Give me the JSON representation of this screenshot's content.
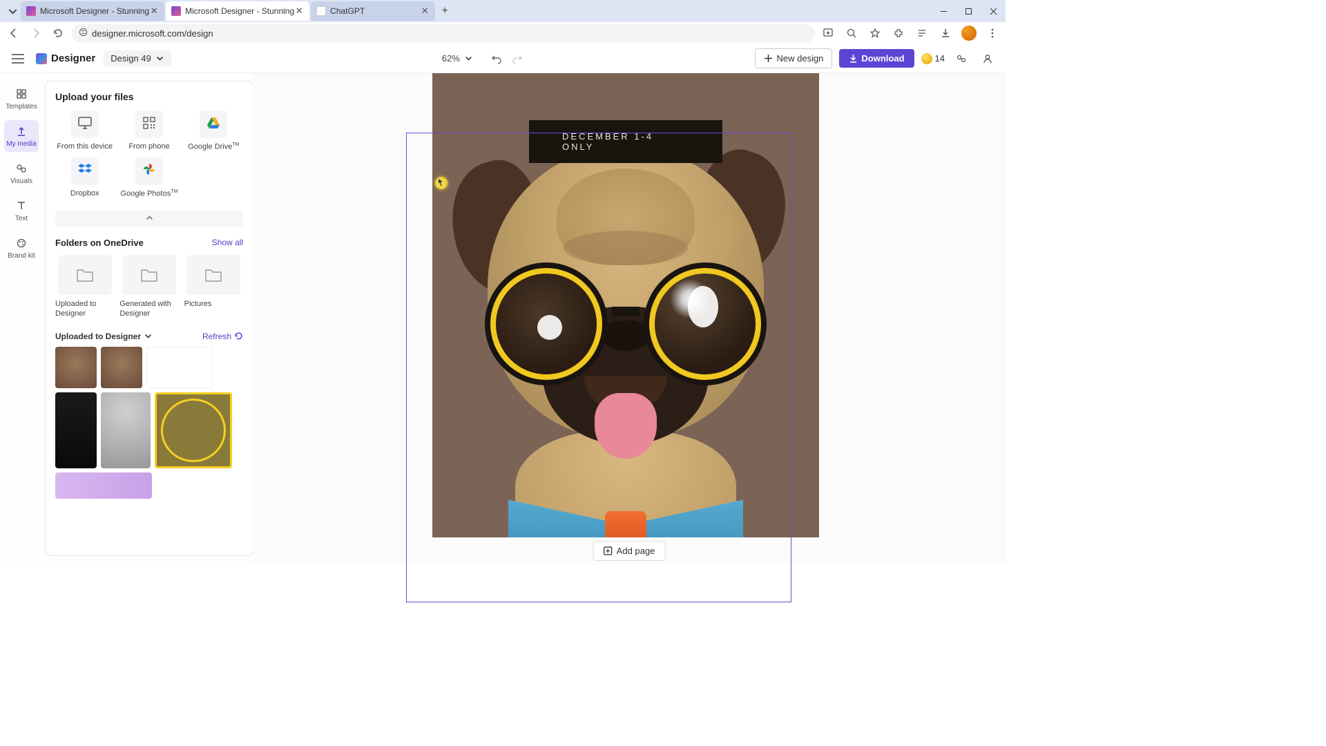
{
  "browser": {
    "tabs": [
      {
        "title": "Microsoft Designer - Stunning",
        "favicon": "designer"
      },
      {
        "title": "Microsoft Designer - Stunning",
        "favicon": "designer",
        "active": true
      },
      {
        "title": "ChatGPT",
        "favicon": "chatgpt"
      }
    ],
    "url": "designer.microsoft.com/design"
  },
  "app": {
    "logo_text": "Designer",
    "design_name": "Design 49",
    "zoom": "62%",
    "new_design_label": "New design",
    "download_label": "Download",
    "coins": "14"
  },
  "rail": {
    "templates": "Templates",
    "my_media": "My media",
    "visuals": "Visuals",
    "text": "Text",
    "brand_kit": "Brand kit"
  },
  "panel": {
    "upload_title": "Upload your files",
    "upload_options": {
      "device": "From this device",
      "phone": "From phone",
      "gdrive": "Google Drive",
      "gdrive_tm": "TM",
      "dropbox": "Dropbox",
      "gphotos": "Google Photos",
      "gphotos_tm": "TM"
    },
    "folders_title": "Folders on OneDrive",
    "show_all": "Show all",
    "folders": {
      "uploaded": "Uploaded to Designer",
      "generated": "Generated with Designer",
      "pictures": "Pictures"
    },
    "uploaded_dropdown": "Uploaded to Designer",
    "refresh": "Refresh"
  },
  "canvas": {
    "banner_text": "DECEMBER 1-4 ONLY",
    "add_page": "Add page"
  }
}
